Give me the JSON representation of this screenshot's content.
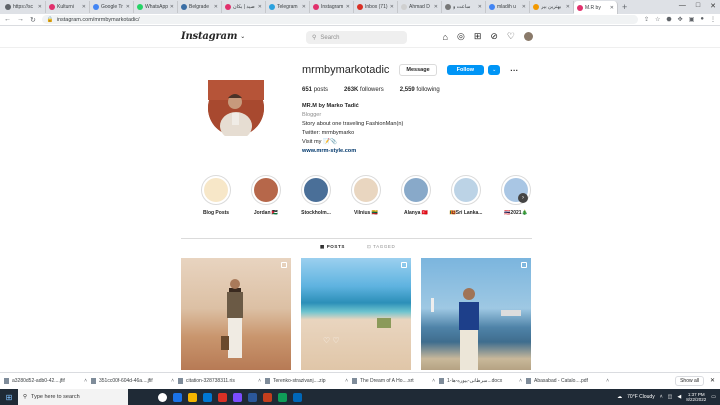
{
  "browser": {
    "tabs": [
      {
        "label": "https://sc",
        "color": "#5f6368"
      },
      {
        "label": "Kulturni",
        "color": "#e1306c"
      },
      {
        "label": "Google Tr",
        "color": "#4285f4"
      },
      {
        "label": "WhatsApp",
        "color": "#25d366"
      },
      {
        "label": "Belgrade",
        "color": "#3a6ea5"
      },
      {
        "label": "صيد | بكان",
        "color": "#e1306c"
      },
      {
        "label": "Telegram",
        "color": "#2aa1de"
      },
      {
        "label": "Instagram",
        "color": "#e1306c"
      },
      {
        "label": "Inbox (71)",
        "color": "#d93025"
      },
      {
        "label": "Ahmad D",
        "color": "#d0d0d0"
      },
      {
        "label": "ساعت و",
        "color": "#777"
      },
      {
        "label": "mladih u",
        "color": "#4285f4"
      },
      {
        "label": "بهترین بیر",
        "color": "#f29900"
      },
      {
        "label": "M.R by",
        "color": "#e1306c",
        "active": true
      }
    ],
    "new_tab": "+",
    "url": "instagram.com/mrmbymarkotadic/"
  },
  "ig": {
    "logo": "Instagram",
    "search_placeholder": "Search"
  },
  "profile": {
    "username": "mrmbymarkotadic",
    "message_label": "Message",
    "follow_label": "Follow",
    "posts_count": "651",
    "posts_label": "posts",
    "followers_count": "263K",
    "followers_label": "followers",
    "following_count": "2,559",
    "following_label": "following",
    "full_name": "MR.M by Marko Tadić",
    "category": "Blogger",
    "bio_line1": "Story about one traveling FashionMan(n)",
    "bio_line2": "Twitter: mrmbymarko",
    "bio_line3": "Visit my 📝📎",
    "website": "www.mrm-style.com"
  },
  "highlights": [
    {
      "label": "Blog Posts",
      "color": "#f7e7c8"
    },
    {
      "label": "Jordan 🇯🇴",
      "color": "#b6674a"
    },
    {
      "label": "Stockholm...",
      "color": "#4a6f98"
    },
    {
      "label": "Vilnius 🇱🇹",
      "color": "#e9d6c0"
    },
    {
      "label": "Alanya 🇹🇷",
      "color": "#88a9c9"
    },
    {
      "label": "🇱🇰Sri Lanka...",
      "color": "#bcd3e6"
    },
    {
      "label": "🇹🇭2021🎄",
      "color": "#a9c6e4"
    }
  ],
  "post_tabs": {
    "posts": "POSTS",
    "tagged": "TAGGED"
  },
  "downloads": [
    {
      "label": "a3280d52-adb0-42....jfif"
    },
    {
      "label": "351cc00f-604d-46a....jfif"
    },
    {
      "label": "citation-328738311.ris"
    },
    {
      "label": "Terenko-strazivanj....zip"
    },
    {
      "label": "The Dream of A Ho....srt"
    },
    {
      "label": "سرطانی-بیوره-ها-1...docx"
    },
    {
      "label": "Abasabad - Catalo....pdf"
    }
  ],
  "show_all": "Show all",
  "taskbar": {
    "search_placeholder": "Type here to search",
    "weather": "70°F  Cloudy",
    "time": "1:37 PM",
    "date": "8/22/2022"
  }
}
